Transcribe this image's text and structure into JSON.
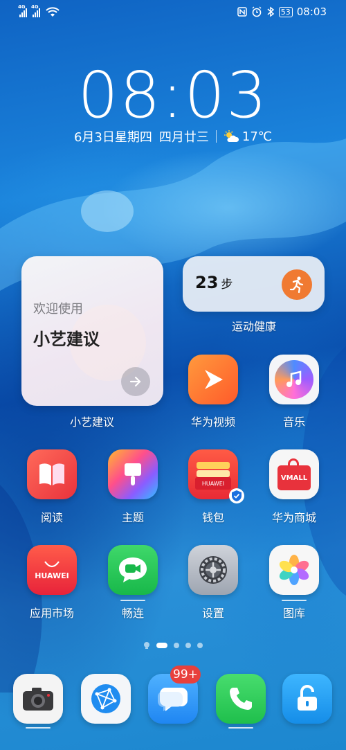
{
  "status_bar": {
    "sim1": "4G",
    "sim2": "4G",
    "battery": "53",
    "time": "08:03",
    "icons": [
      "signal-icon",
      "signal-icon",
      "wifi-icon",
      "nfc-icon",
      "alarm-icon",
      "bluetooth-icon",
      "battery-icon"
    ]
  },
  "lockclock": {
    "time": "08:03",
    "date": "6月3日星期四",
    "lunar": "四月廿三",
    "temperature": "17℃",
    "weather_icon": "partly-sunny-icon"
  },
  "widgets": {
    "suggestion": {
      "welcome": "欢迎使用",
      "title": "小艺建议",
      "label": "小艺建议"
    },
    "health": {
      "steps": "23",
      "unit": "步",
      "label": "运动健康"
    }
  },
  "apps": [
    {
      "label": "华为视频",
      "icon": "huawei-video-icon"
    },
    {
      "label": "音乐",
      "icon": "music-icon"
    },
    {
      "label": "阅读",
      "icon": "book-icon"
    },
    {
      "label": "主题",
      "icon": "brush-icon"
    },
    {
      "label": "钱包",
      "icon": "wallet-icon",
      "card_text": "HUAWEI"
    },
    {
      "label": "华为商城",
      "icon": "vmall-icon",
      "logo_text": "VMALL"
    },
    {
      "label": "应用市场",
      "icon": "appgallery-icon",
      "logo_text": "HUAWEI"
    },
    {
      "label": "畅连",
      "icon": "meetime-icon"
    },
    {
      "label": "设置",
      "icon": "gear-icon"
    },
    {
      "label": "图库",
      "icon": "gallery-icon"
    }
  ],
  "page_indicator": {
    "pages": 4,
    "current": 1
  },
  "dock": {
    "apps": [
      "camera-icon",
      "browser-icon",
      "messages-icon",
      "phone-icon",
      "lock-icon"
    ],
    "messages_badge": "99+"
  },
  "colors": {
    "health_accent": "#f07a32",
    "badge": "#e8403c"
  }
}
